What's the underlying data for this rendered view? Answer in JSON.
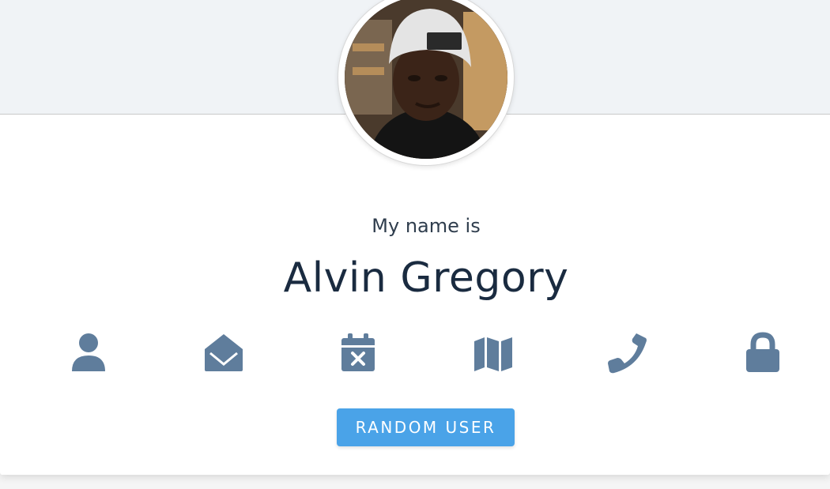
{
  "profile": {
    "label": "My name is",
    "value": "Alvin Gregory"
  },
  "icons": [
    {
      "name": "user-icon"
    },
    {
      "name": "envelope-open-icon"
    },
    {
      "name": "calendar-times-icon"
    },
    {
      "name": "map-icon"
    },
    {
      "name": "phone-icon"
    },
    {
      "name": "lock-icon"
    }
  ],
  "button": {
    "label": "RANDOM USER"
  },
  "colors": {
    "header_bg": "#f0f3f6",
    "icon": "#5f7d9c",
    "button_bg": "#4aa3e8",
    "value_text": "#1a2b40"
  }
}
